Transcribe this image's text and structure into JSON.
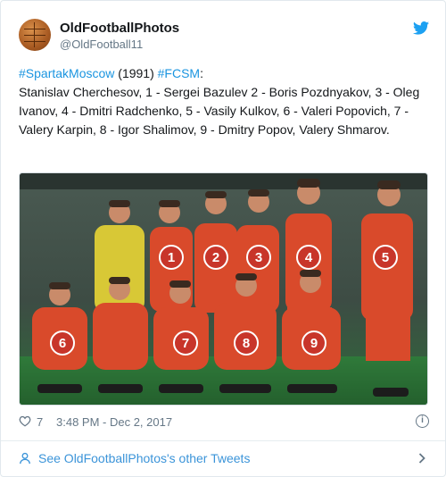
{
  "tweet": {
    "display_name": "OldFootballPhotos",
    "handle": "@OldFootball11",
    "line1_tag1": "#SpartakMoscow",
    "line1_year": " (1991) ",
    "line1_tag2": "#FCSM",
    "line1_colon": ":",
    "body": "Stanislav Cherchesov, 1 - Sergei Bazulev 2 - Boris Pozdnyakov, 3 - Oleg Ivanov, 4 - Dmitri Radchenko, 5 - Vasily Kulkov, 6 - Valeri Popovich, 7 - Valery Karpin, 8 - Igor Shalimov, 9 - Dmitry Popov, Valery Shmarov.",
    "likes": "7",
    "timestamp": "3:48 PM - Dec 2, 2017",
    "footer_link": "See OldFootballPhotos's other Tweets"
  },
  "photo": {
    "badges": [
      "1",
      "2",
      "3",
      "4",
      "5",
      "6",
      "7",
      "8",
      "9"
    ]
  },
  "icons": {
    "brand": "twitter-bird-icon",
    "like": "heart-icon",
    "info": "info-icon",
    "person": "person-icon",
    "chevron": "chevron-right-icon"
  },
  "colors": {
    "link_blue": "#1b95e0",
    "kit_red": "#d94a2b",
    "badge_red": "#c8352a"
  }
}
